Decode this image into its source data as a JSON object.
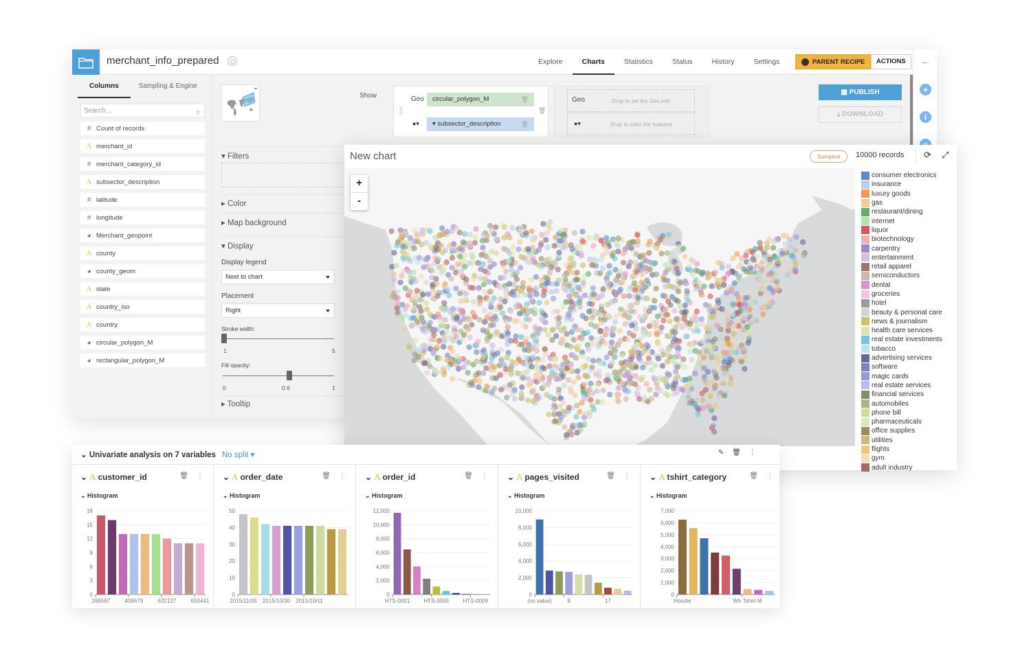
{
  "app": {
    "dataset_title": "merchant_info_prepared",
    "nav_tabs": [
      "Explore",
      "Charts",
      "Statistics",
      "Status",
      "History",
      "Settings"
    ],
    "active_tab": "Charts",
    "parent_recipe_label": "PARENT RECIPE",
    "actions_label": "ACTIONS",
    "publish_label": "PUBLISH",
    "download_label": "DOWNLOAD",
    "accent_color": "#4d9fd8",
    "parent_recipe_color": "#f0b43d"
  },
  "columns_panel": {
    "tabs": [
      "Columns",
      "Sampling & Engine"
    ],
    "active_tab": "Columns",
    "search_placeholder": "Search...",
    "columns": [
      {
        "type": "number",
        "name": "Count of records"
      },
      {
        "type": "string",
        "name": "merchant_id"
      },
      {
        "type": "number",
        "name": "merchant_category_id"
      },
      {
        "type": "string",
        "name": "subsector_description"
      },
      {
        "type": "number",
        "name": "latitude"
      },
      {
        "type": "number",
        "name": "longitude"
      },
      {
        "type": "geo",
        "name": "Merchant_geopoint"
      },
      {
        "type": "string",
        "name": "county"
      },
      {
        "type": "geo",
        "name": "county_geom"
      },
      {
        "type": "string",
        "name": "state"
      },
      {
        "type": "string",
        "name": "country_iso"
      },
      {
        "type": "string",
        "name": "country"
      },
      {
        "type": "geo",
        "name": "circular_polygon_M"
      },
      {
        "type": "geo",
        "name": "rectangular_polygon_M"
      }
    ]
  },
  "settings_panel": {
    "filters_label": "Filters",
    "color_label": "Color",
    "map_background_label": "Map background",
    "display_label": "Display",
    "display_legend_label": "Display legend",
    "display_legend_value": "Next to chart",
    "placement_label": "Placement",
    "placement_value": "Right",
    "stroke_width_label": "Stroke width:",
    "stroke_width": {
      "min": "1",
      "max": "5",
      "value": 1
    },
    "fill_opacity_label": "Fill opacity:",
    "fill_opacity": {
      "min": "0",
      "mid": "0.6",
      "max": "1",
      "value": 0.6
    },
    "tooltip_label": "Tooltip"
  },
  "config": {
    "show_label": "Show",
    "geo_label": "Geo",
    "geo_value": "circular_polygon_M",
    "color_value": "subsector_description",
    "geo_label_2": "Geo",
    "geo_hint": "Drop to set the Geo info",
    "color_hint": "Drop to color the features"
  },
  "chart": {
    "title": "New chart",
    "sampled_label": "Sampled",
    "records_label": "10000 records",
    "zoom_in": "+",
    "zoom_out": "-",
    "legend": [
      {
        "label": "consumer electronics",
        "color": "#5b8fc4"
      },
      {
        "label": "insurance",
        "color": "#b7cde8"
      },
      {
        "label": "luxury goods",
        "color": "#ec9a5a"
      },
      {
        "label": "gas",
        "color": "#f4c99b"
      },
      {
        "label": "restaurant/dining",
        "color": "#63ad66"
      },
      {
        "label": "internet",
        "color": "#b9e2b0"
      },
      {
        "label": "liquor",
        "color": "#d5585e"
      },
      {
        "label": "biotechnology",
        "color": "#f0aeae"
      },
      {
        "label": "carpentry",
        "color": "#a487c9"
      },
      {
        "label": "entertainment",
        "color": "#cfc1df"
      },
      {
        "label": "retail apparel",
        "color": "#9c776f"
      },
      {
        "label": "semiconductors",
        "color": "#cdb6ae"
      },
      {
        "label": "dental",
        "color": "#df92cc"
      },
      {
        "label": "groceries",
        "color": "#f2c6dc"
      },
      {
        "label": "hotel",
        "color": "#9a9a9a"
      },
      {
        "label": "beauty & personal care",
        "color": "#d3d3d3"
      },
      {
        "label": "news & journalism",
        "color": "#c9c36a"
      },
      {
        "label": "health care services",
        "color": "#e2e2ad"
      },
      {
        "label": "real estate investments",
        "color": "#72c6d6"
      },
      {
        "label": "tobacco",
        "color": "#bfe2ea"
      },
      {
        "label": "advertising services",
        "color": "#66699a"
      },
      {
        "label": "software",
        "color": "#7f82b9"
      },
      {
        "label": "magic cards",
        "color": "#9698d8"
      },
      {
        "label": "real estate services",
        "color": "#bcbce8"
      },
      {
        "label": "financial services",
        "color": "#7d9164"
      },
      {
        "label": "automobiles",
        "color": "#a7b784"
      },
      {
        "label": "phone bill",
        "color": "#cddc96"
      },
      {
        "label": "pharmaceuticals",
        "color": "#dee6bc"
      },
      {
        "label": "office supplies",
        "color": "#9f8a68"
      },
      {
        "label": "utilities",
        "color": "#ceb77a"
      },
      {
        "label": "flights",
        "color": "#ecc782"
      },
      {
        "label": "gym",
        "color": "#efdcb9"
      },
      {
        "label": "adult industry",
        "color": "#9f6b6b"
      }
    ]
  },
  "univariate": {
    "title": "Univariate analysis on 7 variables",
    "split_label": "No split",
    "histogram_label": "Histogram"
  },
  "chart_data": [
    {
      "type": "bar",
      "title": "customer_id",
      "categories": [
        "269567",
        "",
        "",
        "409679",
        "",
        "",
        "632127",
        "",
        "",
        "650441"
      ],
      "tick_labels": [
        "269567",
        "409679",
        "632127",
        "650441"
      ],
      "values": [
        17,
        16,
        13,
        13,
        13,
        13,
        12,
        11,
        11,
        11
      ],
      "colors": [
        "#c9596a",
        "#6e3a6b",
        "#c06bb8",
        "#aec3e6",
        "#efb97d",
        "#a8de92",
        "#e99a96",
        "#c2acd5",
        "#bb958f",
        "#f1b3d2"
      ],
      "yticks": [
        "0",
        "3",
        "6",
        "9",
        "12",
        "15",
        "18"
      ],
      "ylim": [
        0,
        18
      ]
    },
    {
      "type": "bar",
      "title": "order_date",
      "categories": [
        "2015/11/05",
        "",
        "",
        "2015/10/30",
        "",
        "",
        "2015/10/11",
        "",
        "",
        ""
      ],
      "tick_labels": [
        "2015/11/05",
        "2015/10/30",
        "2015/10/11"
      ],
      "values": [
        48,
        46,
        42,
        41,
        41,
        41,
        41,
        41,
        39,
        39
      ],
      "colors": [
        "#c4c4c4",
        "#dcdc8e",
        "#a8dbe4",
        "#d4a0d0",
        "#4f55a3",
        "#9b9fdc",
        "#8b9d58",
        "#cddc9c",
        "#b89a47",
        "#e3cf96"
      ],
      "yticks": [
        "0",
        "10",
        "20",
        "30",
        "40",
        "50"
      ],
      "ylim": [
        0,
        50
      ]
    },
    {
      "type": "bar",
      "title": "order_id",
      "categories": [
        "HTS-0001",
        "",
        "",
        "",
        "HTS-0005",
        "",
        "",
        "",
        "HTS-0009",
        ""
      ],
      "tick_labels": [
        "HTS-0001",
        "HTS-0005",
        "HTS-0009"
      ],
      "values": [
        11700,
        6450,
        4000,
        2250,
        1150,
        500,
        220,
        100,
        50,
        20
      ],
      "colors": [
        "#8e67b6",
        "#8a5848",
        "#da80c4",
        "#7f7f7f",
        "#bcbd3e",
        "#6cc4d7",
        "#2e3a7a",
        "#7c8a4c",
        "#7a73c8",
        "#aaaaaa"
      ],
      "yticks": [
        "0",
        "2,000",
        "4,000",
        "6,000",
        "8,000",
        "10,000",
        "12,000"
      ],
      "ylim": [
        0,
        12000
      ]
    },
    {
      "type": "bar",
      "title": "pages_visited",
      "categories": [
        "(no value)",
        "",
        "",
        "8",
        "",
        "",
        "",
        "17",
        "",
        ""
      ],
      "tick_labels": [
        "(no value)",
        "8",
        "17"
      ],
      "values": [
        8950,
        2850,
        2750,
        2700,
        2400,
        2350,
        1400,
        800,
        700,
        450
      ],
      "colors": [
        "#3d72ad",
        "#4e55a0",
        "#8c9c55",
        "#9c9fdc",
        "#d6deaa",
        "#c4c4c4",
        "#b79a45",
        "#a64444",
        "#efcb90",
        "#c4addc"
      ],
      "yticks": [
        "0",
        "2,000",
        "4,000",
        "6,000",
        "8,000",
        "10,000"
      ],
      "ylim": [
        0,
        10000
      ]
    },
    {
      "type": "bar",
      "title": "tshirt_category",
      "categories": [
        "Hoodie",
        "",
        "",
        "",
        "",
        "",
        "Wh Tshirt M",
        "",
        ""
      ],
      "tick_labels": [
        "Hoodie",
        "Wh Tshirt M"
      ],
      "values": [
        6250,
        5550,
        4700,
        3500,
        3250,
        2150,
        450,
        380,
        300
      ],
      "colors": [
        "#8c6c3c",
        "#e2b65d",
        "#3d72ad",
        "#7e3c3c",
        "#cf6069",
        "#6f3f6c",
        "#f0b77e",
        "#c26ac0",
        "#a8c2e6"
      ],
      "yticks": [
        "0",
        "1,000",
        "2,000",
        "3,000",
        "4,000",
        "5,000",
        "6,000",
        "7,000"
      ],
      "ylim": [
        0,
        7000
      ]
    }
  ]
}
